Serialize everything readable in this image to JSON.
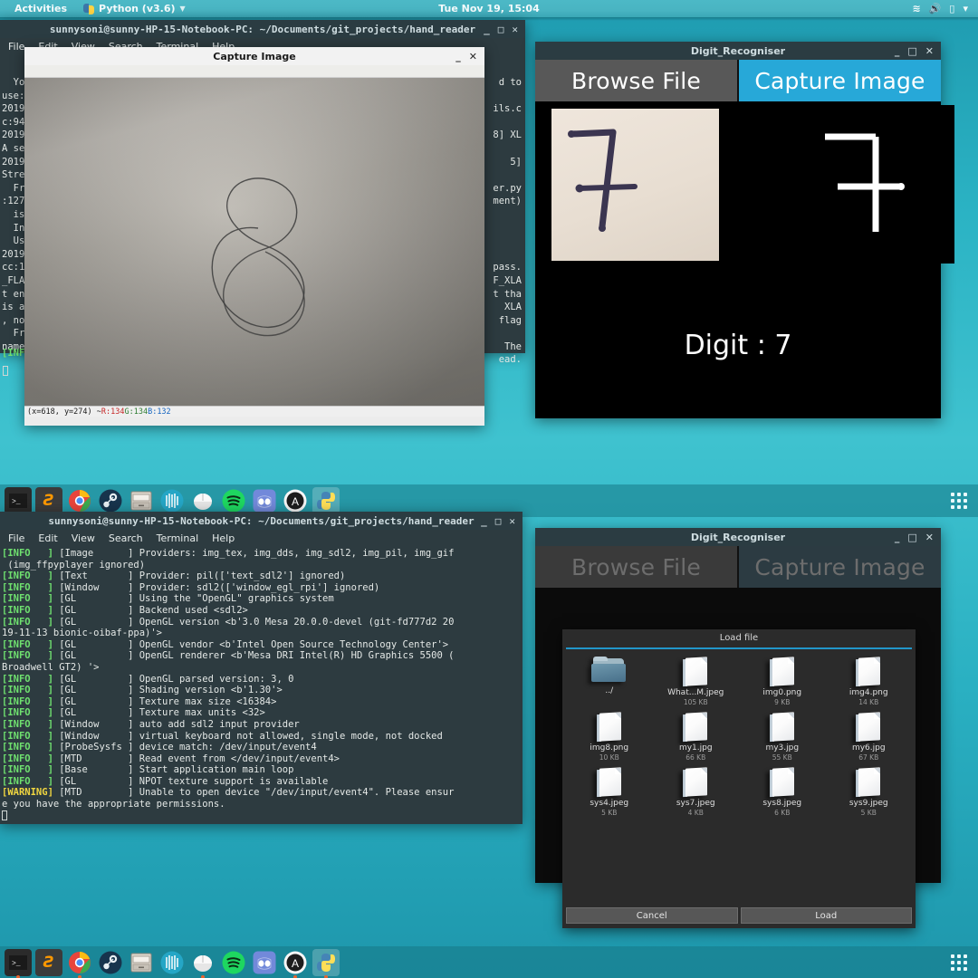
{
  "topbar": {
    "activities": "Activities",
    "app_menu": "Python (v3.6)",
    "clock": "Tue Nov 19, 15:04",
    "tray": [
      "wifi-icon",
      "volume-icon",
      "battery-icon",
      "chevron-down-icon"
    ]
  },
  "terminal1": {
    "title": "sunnysoni@sunny-HP-15-Notebook-PC: ~/Documents/git_projects/hand_reader",
    "menu": [
      "File",
      "Edit",
      "View",
      "Search",
      "Terminal",
      "Help"
    ],
    "left_fragments": "  You\nuse:\n2019\nc:94\n2019\nA se\n2019\nStre\n  Fro\n:127\n  is\n  Ins\n  Use\n2019\ncc:1\n_FLA\nt en\nis a\n, no\n  Fro\nname",
    "right_fragments": "d to\n\nils.c\n\n8] XL\n\n5]\n\ner.py\nment)\n\n\n\n\npass.\nF_XLA\nt tha\n  XLA\n  flag\n\n  The\nead.",
    "prompt_tag": "[INF"
  },
  "capture": {
    "title": "Capture Image",
    "status": {
      "coords": "(x=618, y=274) ~ ",
      "r": "R:134",
      "g": " G:134",
      "b": " B:132"
    },
    "buttons": [
      "minimize",
      "close"
    ]
  },
  "digit_recogniser_top": {
    "title": "Digit_Recogniser",
    "tab_browse": "Browse File",
    "tab_capture": "Capture Image",
    "result_label": "Digit : 7",
    "active_tab": "Capture Image",
    "accent_color": "#27a8d8",
    "buttons": [
      "minimize",
      "maximize",
      "close"
    ]
  },
  "terminal2": {
    "title": "sunnysoni@sunny-HP-15-Notebook-PC: ~/Documents/git_projects/hand_reader",
    "menu": [
      "File",
      "Edit",
      "View",
      "Search",
      "Terminal",
      "Help"
    ],
    "log": [
      {
        "level": "INFO",
        "module": "[Image",
        "text": "] Providers: img_tex, img_dds, img_sdl2, img_pil, img_gif"
      },
      {
        "level": "",
        "module": "",
        "text": " (img_ffpyplayer ignored)"
      },
      {
        "level": "INFO",
        "module": "[Text",
        "text": "] Provider: pil(['text_sdl2'] ignored)"
      },
      {
        "level": "INFO",
        "module": "[Window",
        "text": "] Provider: sdl2(['window_egl_rpi'] ignored)"
      },
      {
        "level": "INFO",
        "module": "[GL",
        "text": "] Using the \"OpenGL\" graphics system"
      },
      {
        "level": "INFO",
        "module": "[GL",
        "text": "] Backend used <sdl2>"
      },
      {
        "level": "INFO",
        "module": "[GL",
        "text": "] OpenGL version <b'3.0 Mesa 20.0.0-devel (git-fd777d2 20"
      },
      {
        "level": "",
        "module": "",
        "text": "19-11-13 bionic-oibaf-ppa)'>"
      },
      {
        "level": "INFO",
        "module": "[GL",
        "text": "] OpenGL vendor <b'Intel Open Source Technology Center'>"
      },
      {
        "level": "INFO",
        "module": "[GL",
        "text": "] OpenGL renderer <b'Mesa DRI Intel(R) HD Graphics 5500 ("
      },
      {
        "level": "",
        "module": "",
        "text": "Broadwell GT2) '>"
      },
      {
        "level": "INFO",
        "module": "[GL",
        "text": "] OpenGL parsed version: 3, 0"
      },
      {
        "level": "INFO",
        "module": "[GL",
        "text": "] Shading version <b'1.30'>"
      },
      {
        "level": "INFO",
        "module": "[GL",
        "text": "] Texture max size <16384>"
      },
      {
        "level": "INFO",
        "module": "[GL",
        "text": "] Texture max units <32>"
      },
      {
        "level": "INFO",
        "module": "[Window",
        "text": "] auto add sdl2 input provider"
      },
      {
        "level": "INFO",
        "module": "[Window",
        "text": "] virtual keyboard not allowed, single mode, not docked"
      },
      {
        "level": "INFO",
        "module": "[ProbeSysfs",
        "text": "] device match: /dev/input/event4"
      },
      {
        "level": "INFO",
        "module": "[MTD",
        "text": "] Read event from </dev/input/event4>"
      },
      {
        "level": "INFO",
        "module": "[Base",
        "text": "] Start application main loop"
      },
      {
        "level": "INFO",
        "module": "[GL",
        "text": "] NPOT texture support is available"
      },
      {
        "level": "WARNING",
        "module": "[MTD",
        "text": "] Unable to open device \"/dev/input/event4\". Please ensur"
      },
      {
        "level": "",
        "module": "",
        "text": "e you have the appropriate permissions."
      }
    ]
  },
  "digit_recogniser_bottom": {
    "title": "Digit_Recogniser",
    "tab_browse": "Browse File",
    "tab_capture": "Capture Image",
    "buttons": [
      "minimize",
      "maximize",
      "close"
    ]
  },
  "load_dialog": {
    "title": "Load file",
    "accent_color": "#2196c9",
    "files": [
      {
        "name": "../",
        "size": "",
        "icon": "folder-icon"
      },
      {
        "name": "What...M.jpeg",
        "size": "105 KB",
        "icon": "document-icon"
      },
      {
        "name": "img0.png",
        "size": "9 KB",
        "icon": "document-icon"
      },
      {
        "name": "img4.png",
        "size": "14 KB",
        "icon": "document-icon"
      },
      {
        "name": "img8.png",
        "size": "10 KB",
        "icon": "document-icon"
      },
      {
        "name": "my1.jpg",
        "size": "66 KB",
        "icon": "document-icon"
      },
      {
        "name": "my3.jpg",
        "size": "55 KB",
        "icon": "document-icon"
      },
      {
        "name": "my6.jpg",
        "size": "67 KB",
        "icon": "document-icon"
      },
      {
        "name": "sys4.jpeg",
        "size": "5 KB",
        "icon": "document-icon"
      },
      {
        "name": "sys7.jpeg",
        "size": "4 KB",
        "icon": "document-icon"
      },
      {
        "name": "sys8.jpeg",
        "size": "6 KB",
        "icon": "document-icon"
      },
      {
        "name": "sys9.jpeg",
        "size": "5 KB",
        "icon": "document-icon"
      }
    ],
    "cancel": "Cancel",
    "load": "Load"
  },
  "dock": {
    "apps": [
      {
        "name": "terminal-icon",
        "glyph": "■",
        "color": "#2b2b2b",
        "running": true
      },
      {
        "name": "sublime-text-icon",
        "glyph": "S",
        "color": "#3b3b3b",
        "running": false
      },
      {
        "name": "chrome-icon",
        "glyph": "",
        "color": "#f2f2f2",
        "running": true
      },
      {
        "name": "steam-icon",
        "glyph": "",
        "color": "#16202b",
        "running": false
      },
      {
        "name": "files-icon",
        "glyph": "",
        "color": "#d8d3cb",
        "running": false
      },
      {
        "name": "sound-app-icon",
        "glyph": "",
        "color": "#1fa7c4",
        "running": false
      },
      {
        "name": "mouse-app-icon",
        "glyph": "",
        "color": "#dcdcdc",
        "running": true
      },
      {
        "name": "spotify-icon",
        "glyph": "",
        "color": "#1ed760",
        "running": false
      },
      {
        "name": "discord-icon",
        "glyph": "",
        "color": "#7289da",
        "running": false
      },
      {
        "name": "ubuntu-software-icon",
        "glyph": "A",
        "color": "#f2f2f2",
        "running": true
      },
      {
        "name": "python-icon",
        "glyph": "",
        "color": "#4584b0",
        "running": true,
        "focused": true
      }
    ],
    "show_apps": "show-applications-icon"
  }
}
